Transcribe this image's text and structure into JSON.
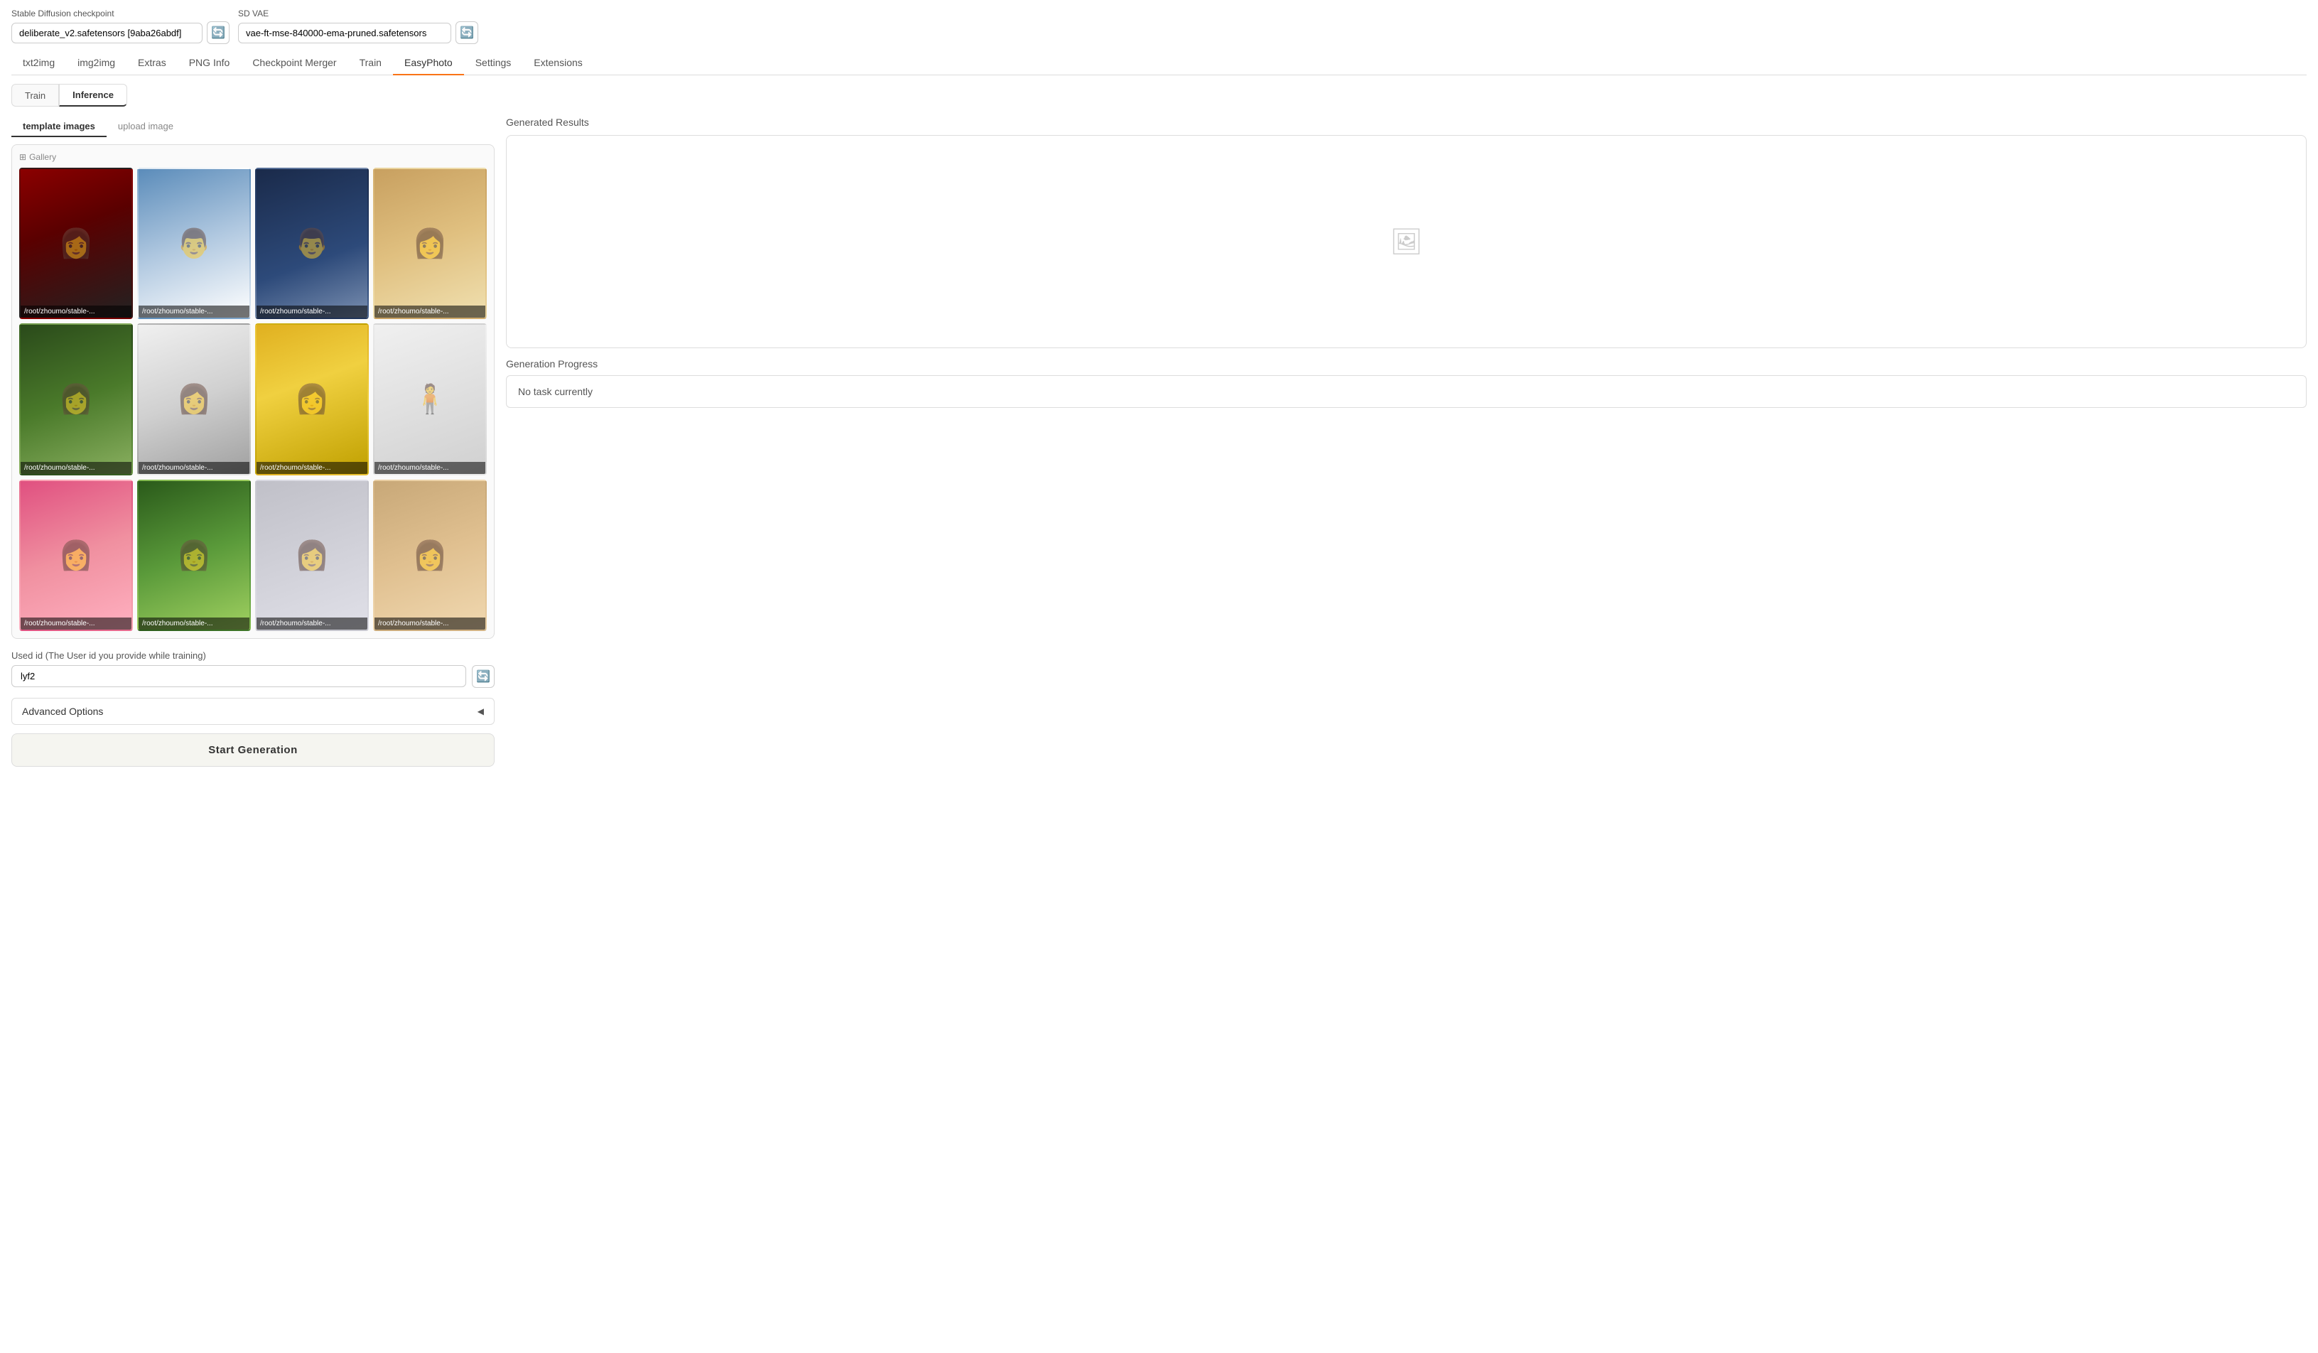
{
  "app": {
    "checkpoint_label": "Stable Diffusion checkpoint",
    "checkpoint_value": "deliberate_v2.safetensors [9aba26abdf]",
    "vae_label": "SD VAE",
    "vae_value": "vae-ft-mse-840000-ema-pruned.safetensors"
  },
  "nav": {
    "tabs": [
      "txt2img",
      "img2img",
      "Extras",
      "PNG Info",
      "Checkpoint Merger",
      "Train",
      "EasyPhoto",
      "Settings",
      "Extensions"
    ],
    "active": "EasyPhoto"
  },
  "subtabs": {
    "tabs": [
      "Train",
      "Inference"
    ],
    "active": "Inference"
  },
  "template": {
    "tabs": [
      "template images",
      "upload image"
    ],
    "active": "template images",
    "gallery_label": "Gallery",
    "images": [
      {
        "id": 1,
        "label": "/root/zhoumo/stable-...",
        "style": "portrait-1"
      },
      {
        "id": 2,
        "label": "/root/zhoumo/stable-...",
        "style": "portrait-2"
      },
      {
        "id": 3,
        "label": "/root/zhoumo/stable-...",
        "style": "portrait-3"
      },
      {
        "id": 4,
        "label": "/root/zhoumo/stable-...",
        "style": "portrait-4"
      },
      {
        "id": 5,
        "label": "/root/zhoumo/stable-...",
        "style": "portrait-5"
      },
      {
        "id": 6,
        "label": "/root/zhoumo/stable-...",
        "style": "portrait-6"
      },
      {
        "id": 7,
        "label": "/root/zhoumo/stable-...",
        "style": "portrait-7"
      },
      {
        "id": 8,
        "label": "/root/zhoumo/stable-...",
        "style": "portrait-8"
      },
      {
        "id": 9,
        "label": "/root/zhoumo/stable-...",
        "style": "portrait-9"
      },
      {
        "id": 10,
        "label": "/root/zhoumo/stable-...",
        "style": "portrait-10"
      },
      {
        "id": 11,
        "label": "/root/zhoumo/stable-...",
        "style": "portrait-11"
      },
      {
        "id": 12,
        "label": "/root/zhoumo/stable-...",
        "style": "portrait-12"
      }
    ]
  },
  "user_id": {
    "label": "Used id (The User id you provide while training)",
    "value": "lyf2"
  },
  "advanced": {
    "label": "Advanced Options"
  },
  "start_btn": {
    "label": "Start Generation"
  },
  "results": {
    "generated_label": "Generated Results",
    "progress_label": "Generation Progress",
    "progress_text": "No task currently"
  },
  "icons": {
    "refresh": "🔄",
    "image_placeholder": "🖼",
    "gallery": "⊞",
    "triangle": "◀"
  }
}
